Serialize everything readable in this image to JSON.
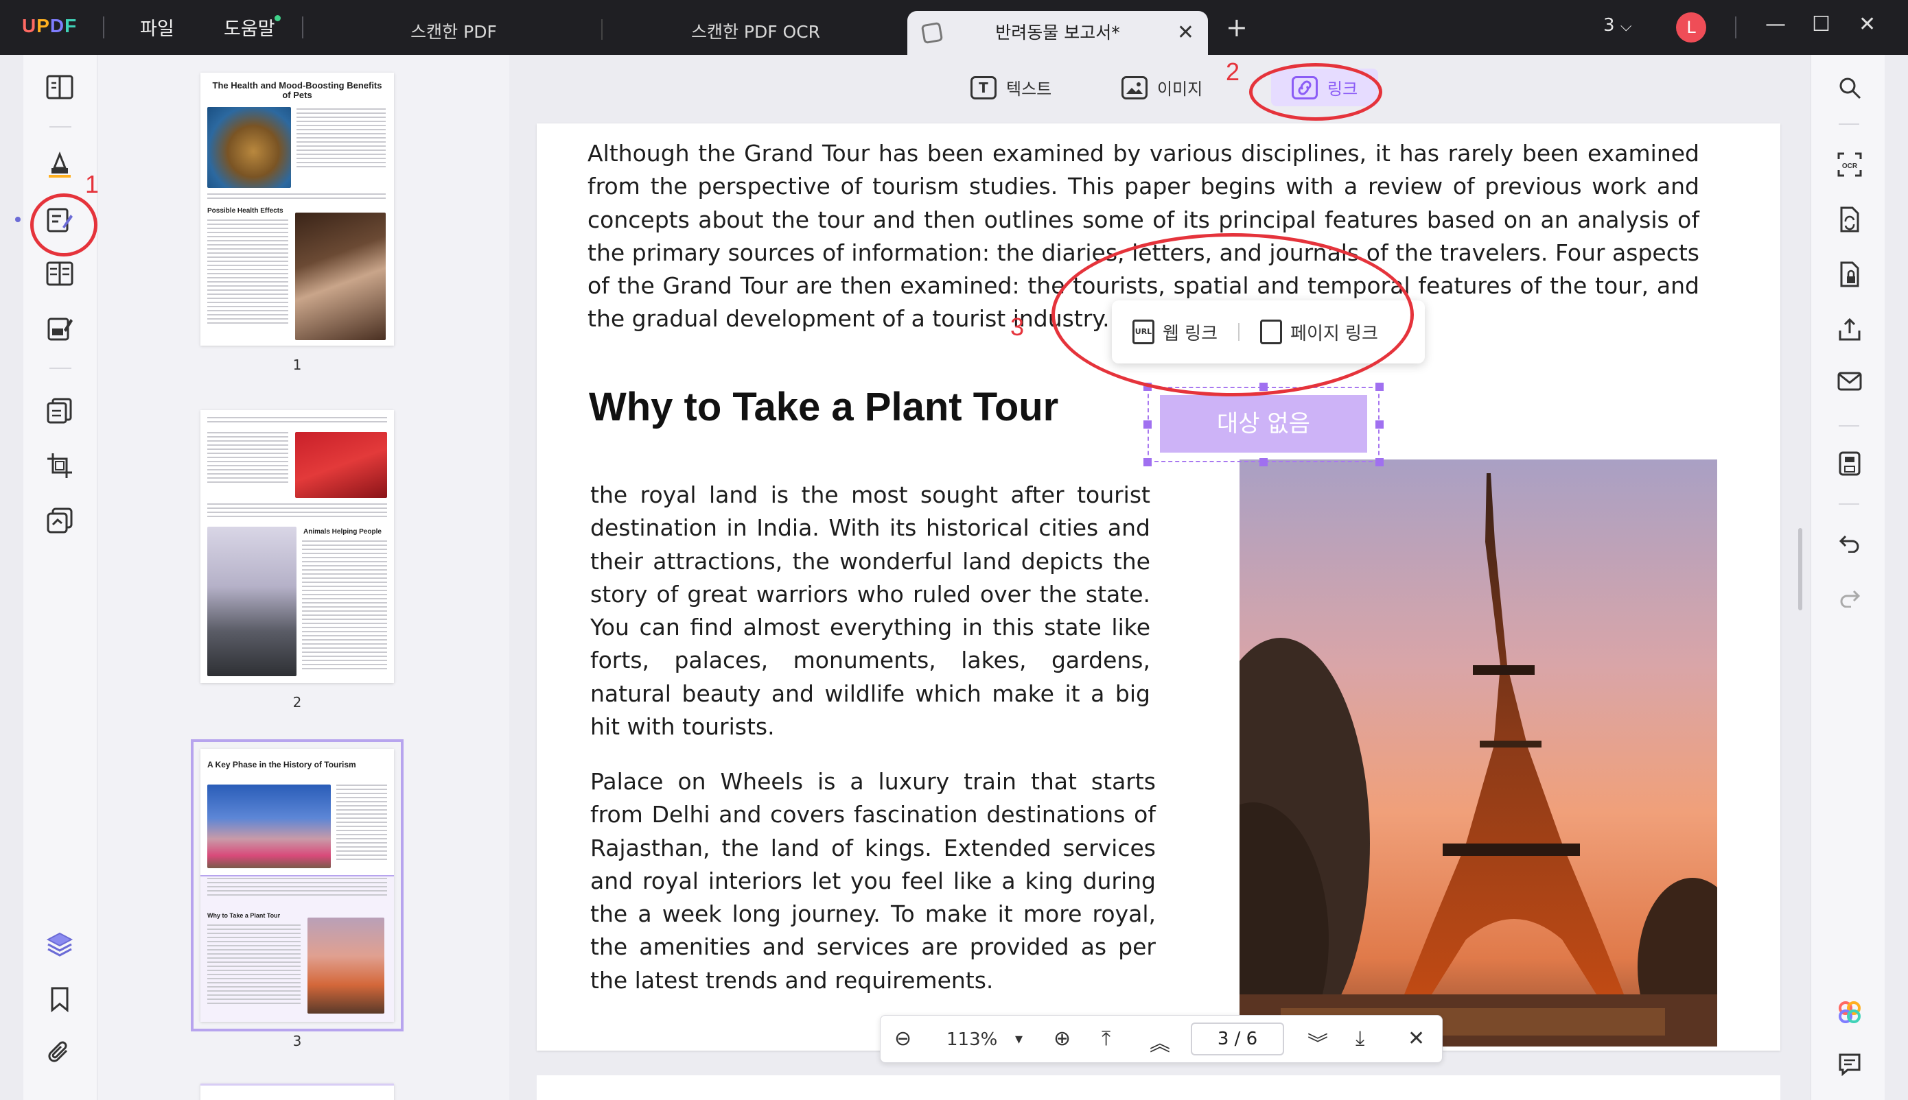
{
  "app": {
    "logo": [
      "U",
      "P",
      "D",
      "F"
    ],
    "menu": {
      "file": "파일",
      "help": "도움말"
    },
    "tabs": [
      {
        "label": "스캔한 PDF"
      },
      {
        "label": "스캔한 PDF OCR"
      },
      {
        "label": "반려동물 보고서*",
        "active": true
      }
    ],
    "tab_close": "✕",
    "tab_add": "+",
    "window_count": "3",
    "window_count_chevron": "⌵",
    "avatar_letter": "L",
    "window_buttons": {
      "minimize": "—",
      "maximize": "☐",
      "close": "✕"
    }
  },
  "edit_toolbar": {
    "text_label": "텍스트",
    "image_label": "이미지",
    "link_label": "링크",
    "text_icon": "T"
  },
  "link_popup": {
    "web_link": "웹 링크",
    "page_link": "페이지 링크",
    "web_icon_text": "URL"
  },
  "link_box": {
    "label": "대상 없음"
  },
  "document": {
    "intro": "Although the Grand Tour has been examined by various disciplines, it has rarely been examined from the perspective of tourism studies. This paper begins with a review of previous work and concepts about the tour and then outlines some of its principal features based on an analysis of the primary sources of information: the diaries, letters, and journals of the travelers. Four aspects of the Grand Tour are then examined: the tourists, spatial and temporal features of the tour, and the gradual development of a tourist industry.",
    "heading": "Why to Take a Plant Tour",
    "para1": "the royal land is the most sought after tourist destination in India. With its historical cities and their attractions, the wonderful land depicts the story of great warriors who ruled over the state. You can find almost everything in this state like forts, palaces, monuments, lakes, gardens, natural beauty and wildlife which make it a big hit with tourists.",
    "para2": "Palace on Wheels is a luxury train that starts from Delhi and covers fascination destinations of Rajasthan, the land of kings. Extended services and royal interiors let you feel like a king during the a week long journey. To make it more royal, the amenities and services are provided as per the latest trends and requirements."
  },
  "thumbnails": [
    {
      "title": "The Health and Mood-Boosting Benefits of Pets",
      "number": "1",
      "section": "Possible Health Effects"
    },
    {
      "title": "",
      "number": "2",
      "section": "Animals Helping People"
    },
    {
      "title": "A Key Phase in the History of Tourism",
      "number": "3",
      "section": "Why to Take a Plant Tour"
    }
  ],
  "navbar": {
    "zoom_out": "⊖",
    "zoom": "113%",
    "zoom_dropdown": "▾",
    "zoom_in": "⊕",
    "first_page": "⤒",
    "prev_page": "︽",
    "page_display": "3 / 6",
    "next_page": "︾",
    "last_page": "⤓",
    "close": "✕"
  },
  "annotations": {
    "n1": "1",
    "n2": "2",
    "n3": "3"
  },
  "colors": {
    "accent": "#8b5cf6",
    "link_fill": "#cdb3f7",
    "annotation_red": "#e5333b",
    "titlebar": "#1f1f23"
  }
}
